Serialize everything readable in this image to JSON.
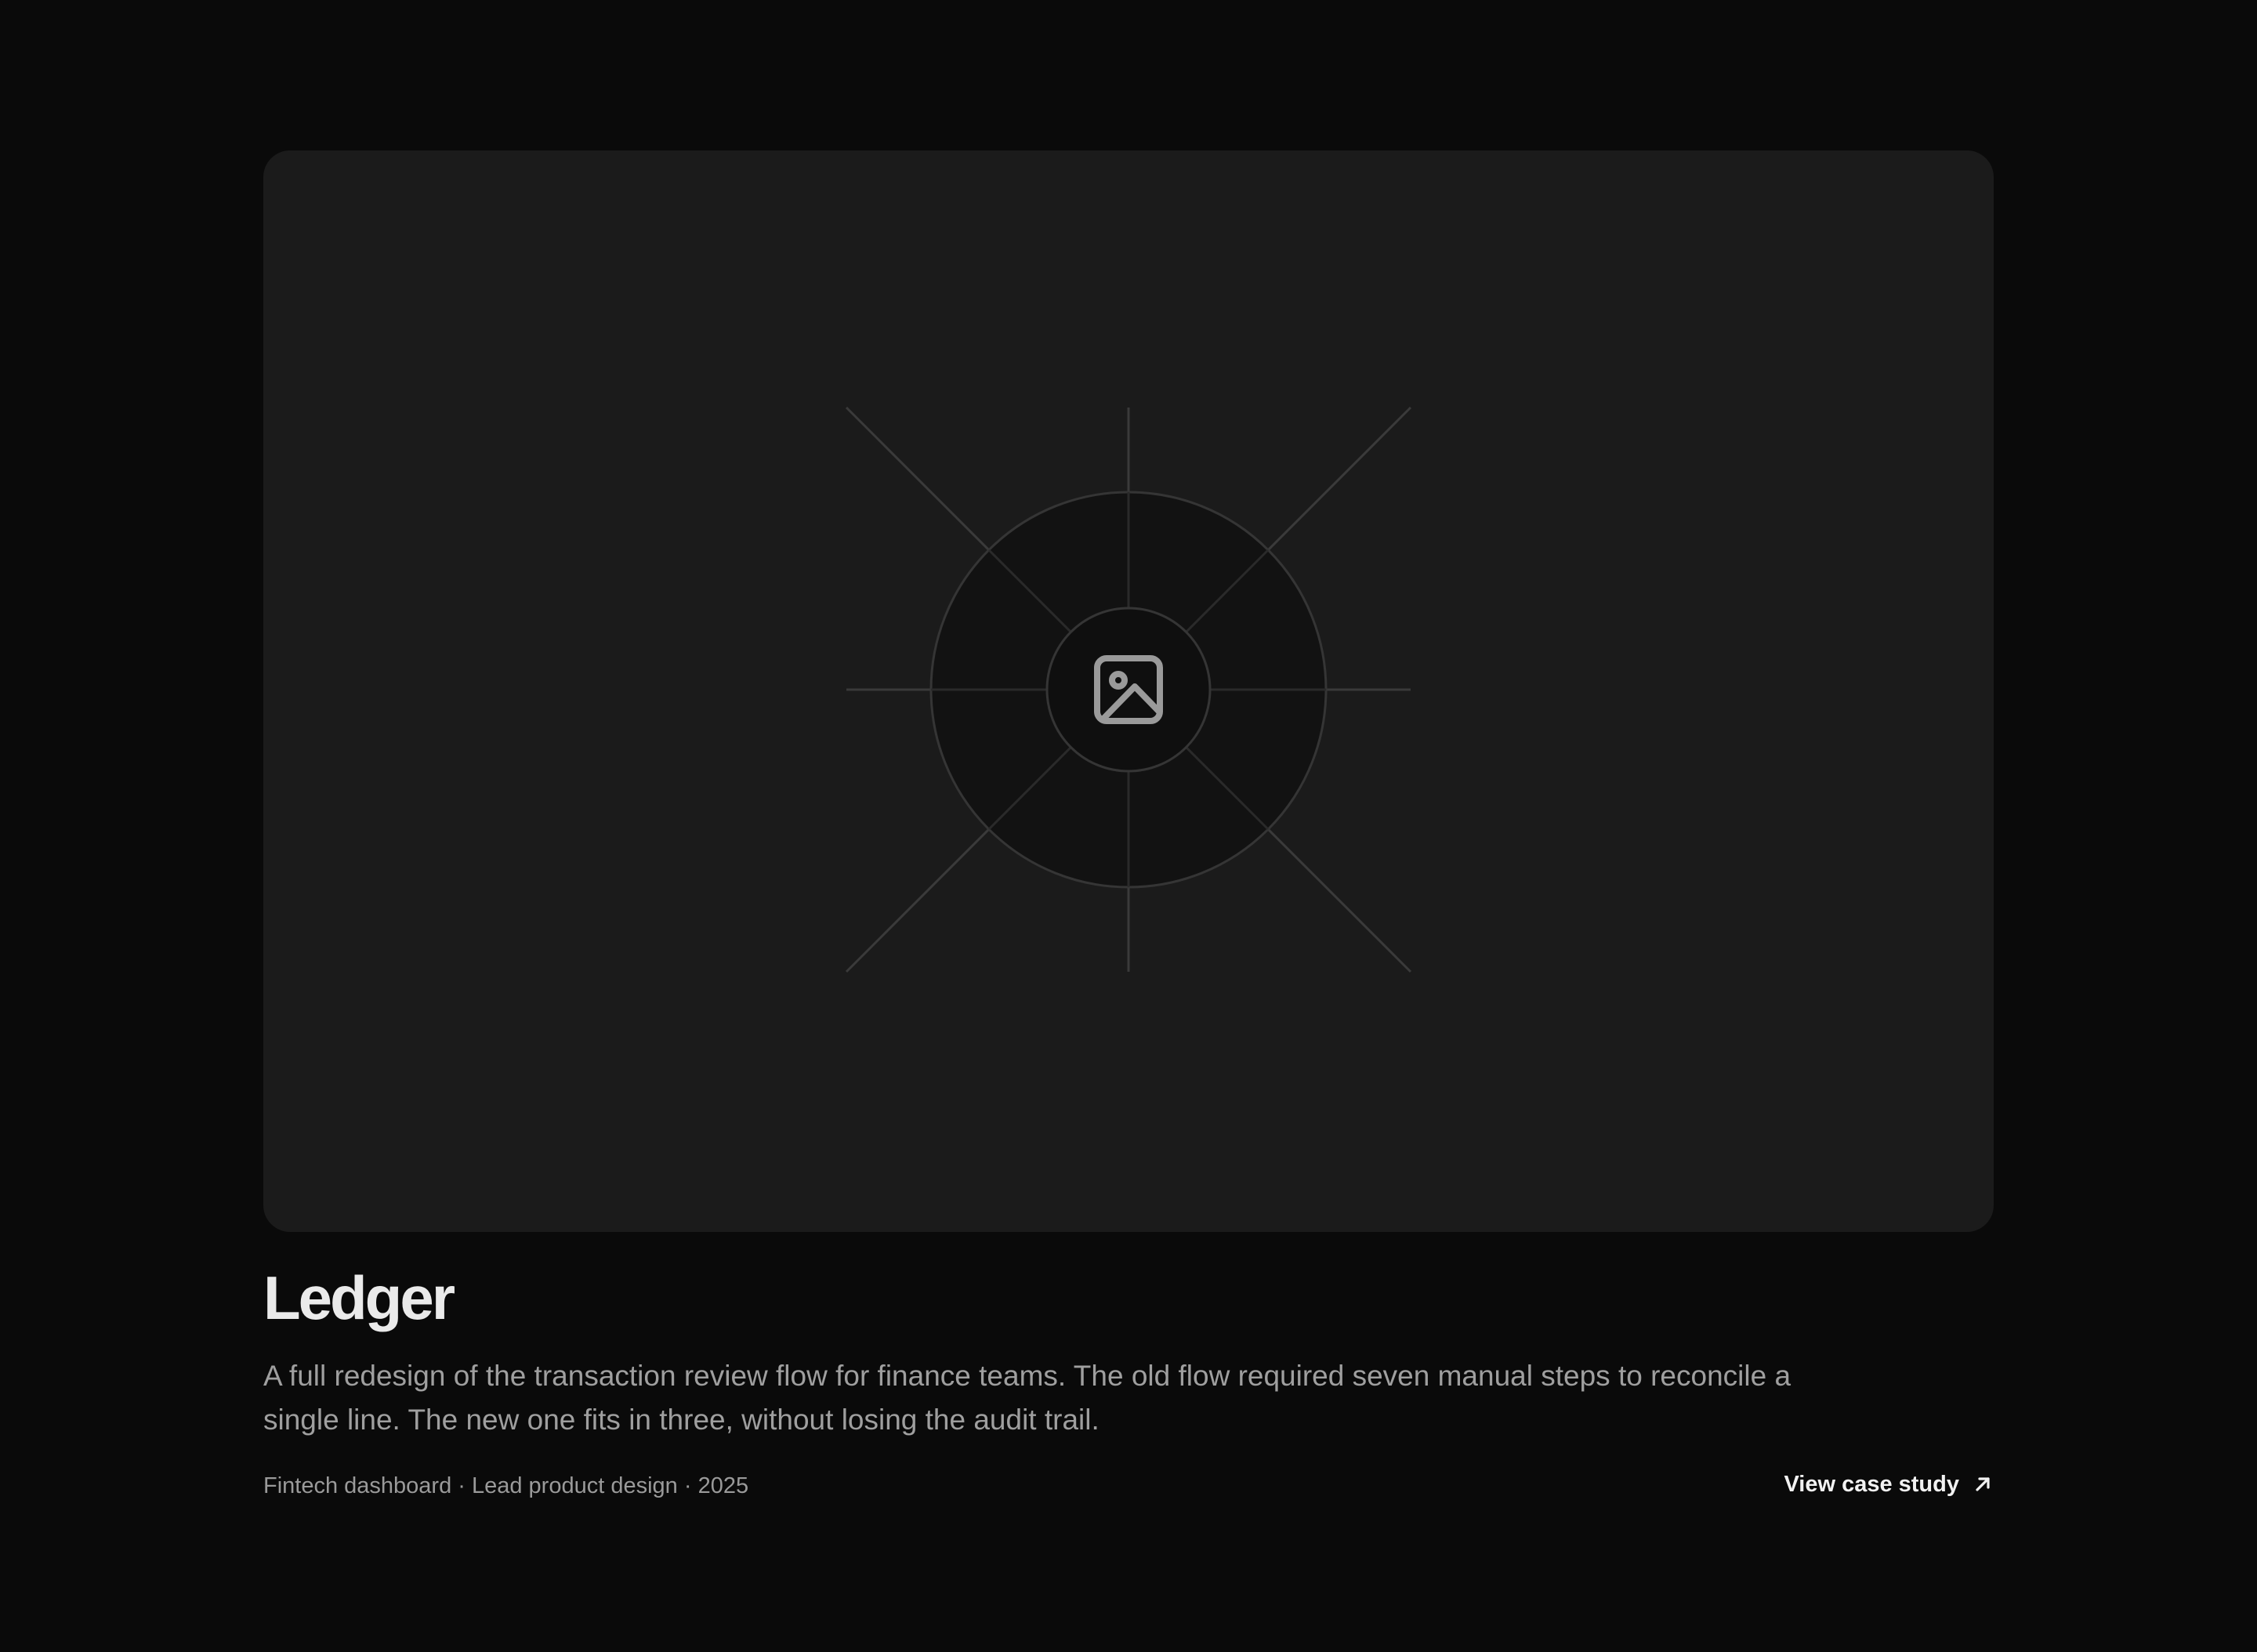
{
  "project": {
    "title": "Ledger",
    "description": "A full redesign of the transaction review flow for finance teams. The old flow required seven manual steps to reconcile a single line. The new one fits in three, without losing the audit trail.",
    "meta": "Fintech dashboard · Lead product design · 2025",
    "cta_label": "View case study"
  },
  "icons": {
    "cover": "image-icon",
    "cta": "arrow-up-right-icon"
  },
  "colors": {
    "background": "#0a0a0a",
    "card": "#1b1b1b",
    "title": "#eaeaea",
    "body": "#9f9f9f",
    "accent_text": "#f2f2f2"
  }
}
